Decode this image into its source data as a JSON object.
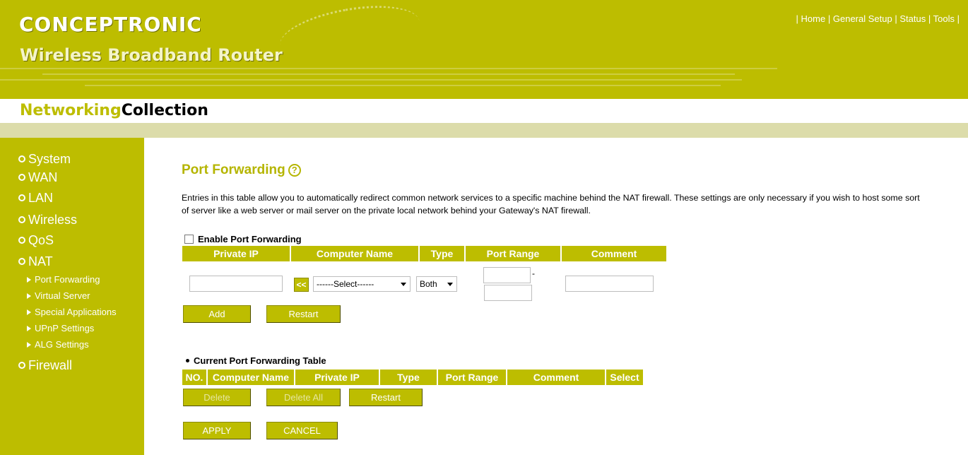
{
  "banner": {
    "brand": "CONCEPTRONIC",
    "product": "Wireless Broadband Router",
    "collection_part1": "Networking",
    "collection_part2": "Collection",
    "topnav": {
      "home": "Home",
      "general_setup": "General Setup",
      "status": "Status",
      "tools": "Tools",
      "separator": "|"
    }
  },
  "sidebar": {
    "items": [
      {
        "label": "System"
      },
      {
        "label": "WAN"
      },
      {
        "label": "LAN"
      },
      {
        "label": "Wireless"
      },
      {
        "label": "QoS"
      },
      {
        "label": "NAT"
      },
      {
        "label": "Firewall"
      }
    ],
    "nat_subitems": [
      {
        "label": "Port Forwarding"
      },
      {
        "label": "Virtual Server"
      },
      {
        "label": "Special Applications"
      },
      {
        "label": "UPnP Settings"
      },
      {
        "label": "ALG Settings"
      }
    ]
  },
  "main": {
    "title": "Port Forwarding",
    "help_glyph": "?",
    "description": "Entries in this table allow you to automatically redirect common network services to a specific machine behind the NAT firewall. These settings are only necessary if you wish to host some sort of server like a web server or mail server on the private local network behind your Gateway's NAT firewall.",
    "enable_label": "Enable Port Forwarding",
    "enable_checked": false,
    "entry_table": {
      "headers": [
        "Private IP",
        "Computer Name",
        "Type",
        "Port Range",
        "Comment"
      ]
    },
    "fields": {
      "private_ip": "",
      "copy_button": "<<",
      "computer_select": "------Select------",
      "type_select": "Both",
      "port_from": "",
      "port_dash": "-",
      "port_to": "",
      "comment": ""
    },
    "buttons": {
      "add": "Add",
      "restart": "Restart"
    },
    "current_table": {
      "title": "Current Port Forwarding Table",
      "headers": [
        "NO.",
        "Computer Name",
        "Private IP",
        "Type",
        "Port Range",
        "Comment",
        "Select"
      ]
    },
    "table_buttons": {
      "delete": "Delete",
      "delete_all": "Delete All",
      "restart": "Restart"
    },
    "form_buttons": {
      "apply": "APPLY",
      "cancel": "CANCEL"
    }
  },
  "colors": {
    "accent": "#bdbd00",
    "strip": "#dcdcaa",
    "heading": "#b5b500"
  }
}
